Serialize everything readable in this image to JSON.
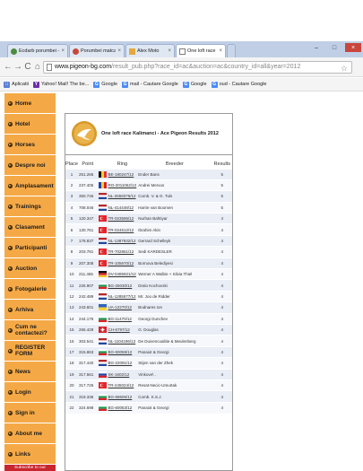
{
  "browser": {
    "tabs": [
      {
        "label": "Ecdarb porumbei - Club",
        "icon_color": "#4c8c3d"
      },
      {
        "label": "Porumbei matca - Inbreu",
        "icon_color": "#c7473a"
      },
      {
        "label": "Alex Moto",
        "icon_color": "#e4a93a"
      },
      {
        "label": "One loft race Kalimanci",
        "icon_color": "#7b7b7b"
      }
    ],
    "url_host": "www.pigeon-bg.com",
    "url_path": "/result_pub.php?race_id=ac&auction=ac&country_id=all&year=2012",
    "bookmarks": [
      {
        "label": "Aplicatii",
        "icon_color": "#5c7fd6",
        "glyph": "::"
      },
      {
        "label": "Yahoo! Mail! The be...",
        "icon_color": "#6b2fa6",
        "glyph": "Y"
      },
      {
        "label": "Google",
        "icon_color": "#4c8bf5",
        "glyph": "G"
      },
      {
        "label": "mail - Cautare Google",
        "icon_color": "#4c8bf5",
        "glyph": "G"
      },
      {
        "label": "Google",
        "icon_color": "#4c8bf5",
        "glyph": "G"
      },
      {
        "label": "oud - Cautare Google",
        "icon_color": "#4c8bf5",
        "glyph": "G"
      }
    ]
  },
  "sidebar": {
    "items": [
      "Home",
      "Hotel",
      "Horses",
      "Despre noi",
      "Amplasament",
      "Trainings",
      "Clasament",
      "Participanti",
      "Auction",
      "Fotogalerie",
      "Arhiva",
      "Cum ne contactezi?",
      "REGISTER FORM",
      "News",
      "Login",
      "Sign in",
      "About me",
      "Links"
    ],
    "subscribe_label": "Subscribe to our Newsletter",
    "accent": "#f5a946"
  },
  "page": {
    "title": "One loft race Kalimanci - Ace Pigeon Results  2012",
    "columns": [
      "Place",
      "Point",
      "Ring",
      "Breeder",
      "Results"
    ]
  },
  "results": [
    {
      "place": "1",
      "point": "251.265",
      "flag": "be",
      "ring": "BE-180247/12",
      "breeder": "Ender Bans",
      "result": "5"
    },
    {
      "place": "2",
      "point": "237.405",
      "flag": "ro",
      "ring": "RO-2011062/12",
      "breeder": "Andrei Mervus",
      "result": "5"
    },
    {
      "place": "3",
      "point": "350.746",
      "flag": "nl",
      "ring": "NL-2659376/12",
      "breeder": "Comb. V. & G. Tuls",
      "result": "5"
    },
    {
      "place": "4",
      "point": "708.046",
      "flag": "nl",
      "ring": "NL-414449/12",
      "breeder": "Harrie van Boomen",
      "result": "5"
    },
    {
      "place": "5",
      "point": "120.347",
      "flag": "tr",
      "ring": "TR-023596/12",
      "breeder": "Nurhan Bahtiyar",
      "result": "4"
    },
    {
      "place": "6",
      "point": "130.761",
      "flag": "tr",
      "ring": "TR-024512/12",
      "breeder": "Ibrahim Akin",
      "result": "4"
    },
    {
      "place": "7",
      "point": "178.837",
      "flag": "nl",
      "ring": "NL-1387932/12",
      "breeder": "Gerrard Schelleyk",
      "result": "4"
    },
    {
      "place": "8",
      "point": "203.781",
      "flag": "tr",
      "ring": "TR-702851/12",
      "breeder": "Sedi KARDESLER",
      "result": "4"
    },
    {
      "place": "9",
      "point": "207.308",
      "flag": "tr",
      "ring": "TR-105670/12",
      "breeder": "Bornova Belediyesi",
      "result": "4"
    },
    {
      "place": "10",
      "point": "211.465",
      "flag": "dv",
      "ring": "DV-0485921/12",
      "breeder": "Werner A Walbie + Silvia Thiel",
      "result": "4"
    },
    {
      "place": "11",
      "point": "226.907",
      "flag": "bg",
      "ring": "BG-25030/12",
      "breeder": "Dralo Kochovski",
      "result": "4"
    },
    {
      "place": "12",
      "point": "242.489",
      "flag": "nl",
      "ring": "NL-1285577/12",
      "breeder": "Mr. Joo de Ridder",
      "result": "4"
    },
    {
      "place": "13",
      "point": "243.601",
      "flag": "ua",
      "ring": "UA-12270/12",
      "breeder": "Bodnares Ion",
      "result": "4"
    },
    {
      "place": "14",
      "point": "244.176",
      "flag": "bg",
      "ring": "BG-11470/12",
      "breeder": "Georgi Gunchev",
      "result": "4"
    },
    {
      "place": "15",
      "point": "265.429",
      "flag": "ch",
      "ring": "CH-6797/12",
      "breeder": "G. Douglas",
      "result": "4"
    },
    {
      "place": "16",
      "point": "303.541",
      "flag": "nl",
      "ring": "NL-1104196/12",
      "breeder": "De Duivencoalitie & Meulenberg",
      "result": "4"
    },
    {
      "place": "17",
      "point": "315.863",
      "flag": "bg",
      "ring": "BG-60059/12",
      "breeder": "Panaiot & Georgi",
      "result": "4"
    },
    {
      "place": "18",
      "point": "317.440",
      "flag": "nl",
      "ring": "BG-22091/12",
      "breeder": "Stijen van der Zhek",
      "result": "4"
    },
    {
      "place": "19",
      "point": "317.561",
      "flag": "sk",
      "ring": "SK-1602/12",
      "breeder": "Vinkove\\ .",
      "result": "4"
    },
    {
      "place": "20",
      "point": "317.726",
      "flag": "tr",
      "ring": "TR-245024/12",
      "breeder": "Resat-Necic-Umurtak",
      "result": "4"
    },
    {
      "place": "21",
      "point": "319.336",
      "flag": "bg",
      "ring": "BG-68606/12",
      "breeder": "Comb. K.S.J.",
      "result": "4"
    },
    {
      "place": "22",
      "point": "324.698",
      "flag": "bg",
      "ring": "BG-60053/12",
      "breeder": "Panaiot & Georgi",
      "result": "4"
    }
  ]
}
